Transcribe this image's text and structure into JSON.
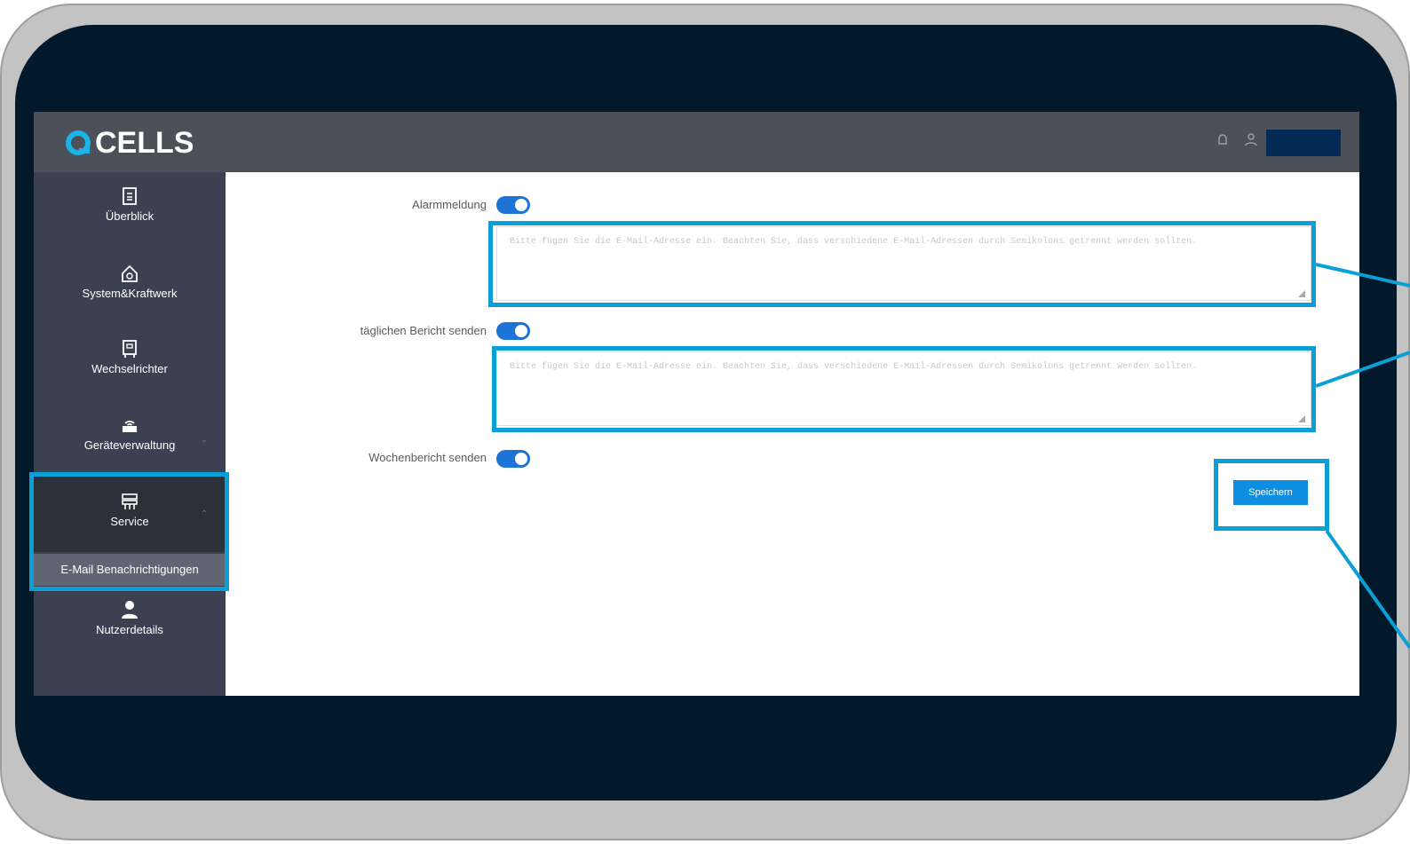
{
  "brand": {
    "logo_text": "CELLS",
    "accent_color": "#0aa0d6"
  },
  "header": {
    "icons": [
      "notification-icon",
      "user-icon"
    ],
    "user_name": ""
  },
  "sidebar": {
    "items": [
      {
        "label": "Überblick",
        "icon": "document-icon"
      },
      {
        "label": "System&Kraftwerk",
        "icon": "home-energy-icon"
      },
      {
        "label": "Wechselrichter",
        "icon": "inverter-icon"
      },
      {
        "label": "Geräteverwaltung",
        "icon": "router-icon"
      },
      {
        "label": "Service",
        "icon": "service-icon",
        "expanded": true
      },
      {
        "label": "Nutzerdetails",
        "icon": "user-icon"
      }
    ],
    "submenu": {
      "label": "E-Mail Benachrichtigungen"
    }
  },
  "form": {
    "alarm_label": "Alarmmeldung",
    "alarm_enabled": true,
    "alarm_placeholder": "Bitte fügen Sie die E-Mail-Adresse ein. Beachten Sie, dass verschiedene E-Mail-Adressen durch Semikolons getrennt werden sollten.",
    "daily_label": "täglichen Bericht senden",
    "daily_enabled": true,
    "daily_placeholder": "Bitte fügen Sie die E-Mail-Adresse ein. Beachten Sie, dass verschiedene E-Mail-Adressen durch Semikolons getrennt werden sollten.",
    "weekly_label": "Wochenbericht senden",
    "weekly_enabled": true,
    "save_label": "Speichern"
  },
  "colors": {
    "toggle_on": "#1e73d6",
    "save_button": "#0d8ee0",
    "topbar": "#4c5059",
    "sidebar": "#3b4150"
  }
}
